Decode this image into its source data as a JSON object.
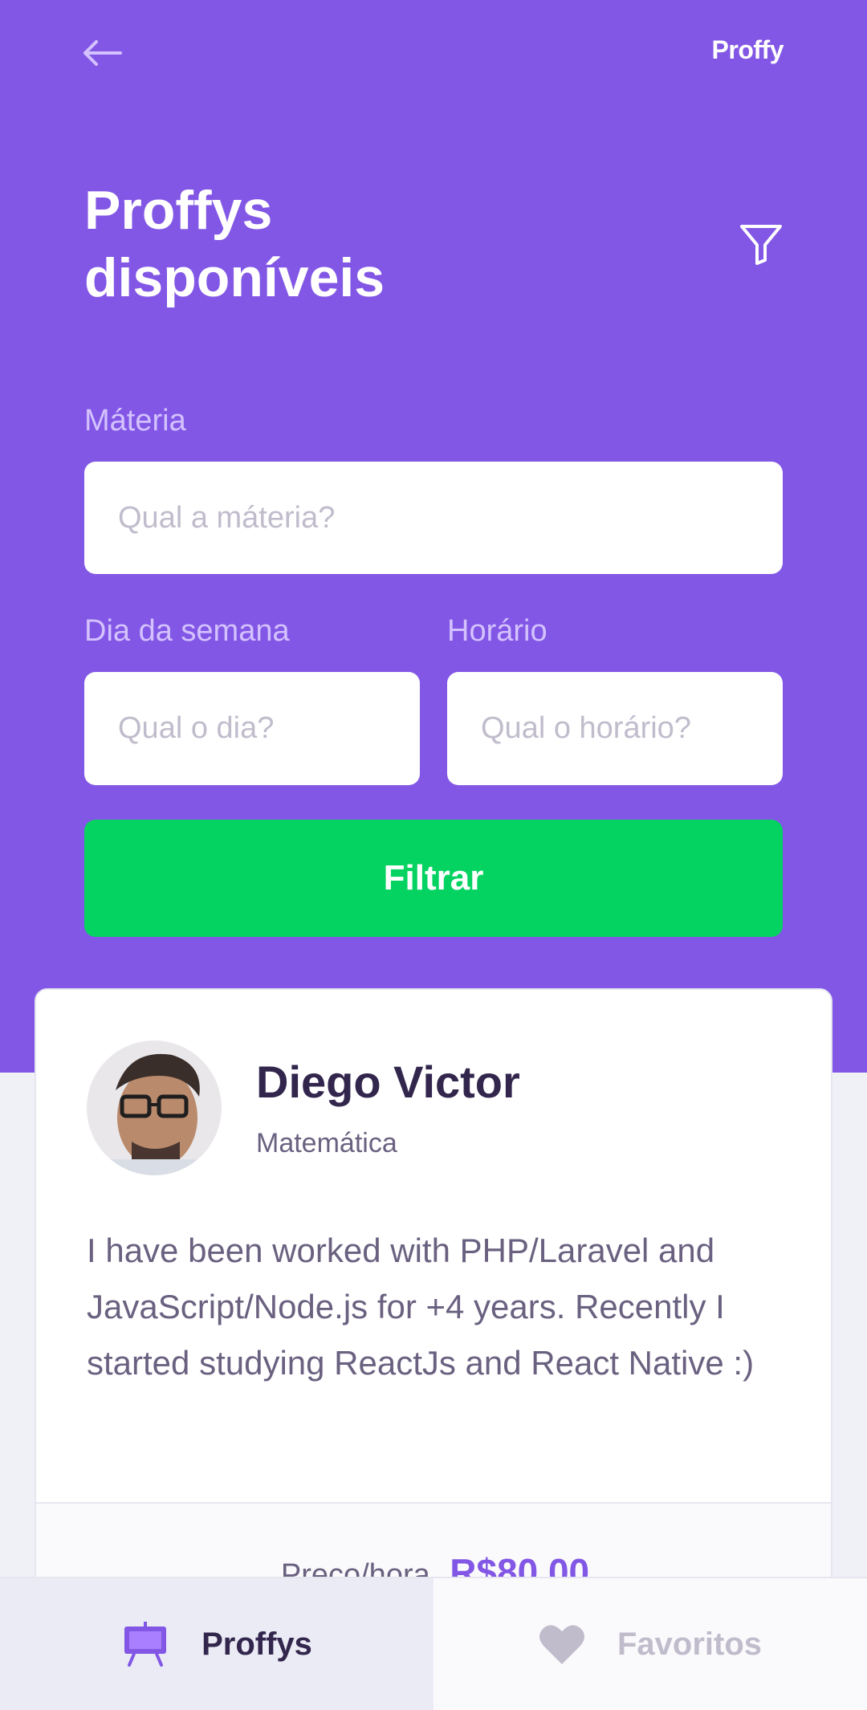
{
  "header": {
    "logo": "Proffy",
    "title_line1": "Proffys",
    "title_line2": "disponíveis"
  },
  "filters": {
    "subject_label": "Máteria",
    "subject_placeholder": "Qual a máteria?",
    "weekday_label": "Dia da semana",
    "weekday_placeholder": "Qual o dia?",
    "time_label": "Horário",
    "time_placeholder": "Qual o horário?",
    "submit_label": "Filtrar"
  },
  "teacher": {
    "name": "Diego Victor",
    "subject": "Matemática",
    "bio": "I have been worked with PHP/Laravel and JavaScript/Node.js for +4 years. Recently I started studying ReactJs and React Native :)",
    "price_label": "Preço/hora",
    "price_value": "R$80,00"
  },
  "tabs": [
    {
      "label": "Proffys",
      "icon": "easel-icon",
      "active": true
    },
    {
      "label": "Favoritos",
      "icon": "heart-icon",
      "active": false
    }
  ],
  "colors": {
    "primary": "#8257E5",
    "secondary": "#04D361",
    "background": "#F0F0F7",
    "title": "#32264D",
    "text": "#6A6180",
    "muted": "#C1BCCC",
    "label_on_primary": "#D4C2FF"
  }
}
